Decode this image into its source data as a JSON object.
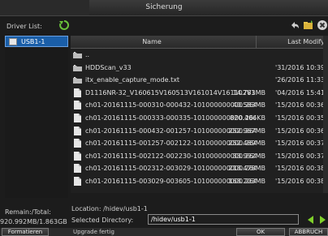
{
  "window": {
    "title": "Sicherung"
  },
  "sidebar": {
    "driver_list_label": "Driver List:",
    "items": [
      {
        "label": "USB1-1"
      }
    ]
  },
  "table": {
    "headers": {
      "name": "Name",
      "modified": "Last Modify"
    },
    "rows": [
      {
        "type": "folder",
        "name": "..",
        "size": "",
        "date": ""
      },
      {
        "type": "folder",
        "name": "HDDScan_v33",
        "size": "",
        "date": "'31/2016 10:39"
      },
      {
        "type": "folder",
        "name": "itx_enable_capture_mode.txt",
        "size": "",
        "date": "'26/2016 11:33"
      },
      {
        "type": "file",
        "name": "D1116NR-32_V160615V160513V161014V161102V16110",
        "size": "14.783MB",
        "date": "'04/2016 15:41"
      },
      {
        "type": "file",
        "name": "ch01-20161115-000310-000432-101000000000.264",
        "size": "40.583MB",
        "date": "'15/2016 00:36"
      },
      {
        "type": "file",
        "name": "ch01-20161115-000333-000335-101000000000.264",
        "size": "820.406KB",
        "date": "'15/2016 00:35"
      },
      {
        "type": "file",
        "name": "ch01-20161115-000432-001257-101000000000.264",
        "size": "252.967MB",
        "date": "'15/2016 00:36"
      },
      {
        "type": "file",
        "name": "ch01-20161115-001257-002122-101000000000.264",
        "size": "252.489MB",
        "date": "'15/2016 00:37"
      },
      {
        "type": "file",
        "name": "ch01-20161115-002122-002230-101000000000.264",
        "size": "33.992MB",
        "date": "'15/2016 00:37"
      },
      {
        "type": "file",
        "name": "ch01-20161115-002312-003029-101000000000.264",
        "size": "218.478MB",
        "date": "'15/2016 00:38"
      },
      {
        "type": "file",
        "name": "ch01-20161115-003029-003605-101000000000.264",
        "size": "168.203MB",
        "date": "'15/2016 00:38"
      }
    ]
  },
  "footer": {
    "remain_label": "Remain:/Total:",
    "remain_value": "920.992MB/1.863GB",
    "location": "Location: /hidev/usb1-1",
    "selected_label": "Selected Directory:",
    "selected_value": "/hidev/usb1-1",
    "status": "Upgrade fertig"
  },
  "buttons": {
    "format": "Formatieren",
    "ok": "OK",
    "cancel": "ABBRUCH"
  },
  "colors": {
    "accent": "#1a5ea8",
    "arrow": "#7fd02a"
  }
}
